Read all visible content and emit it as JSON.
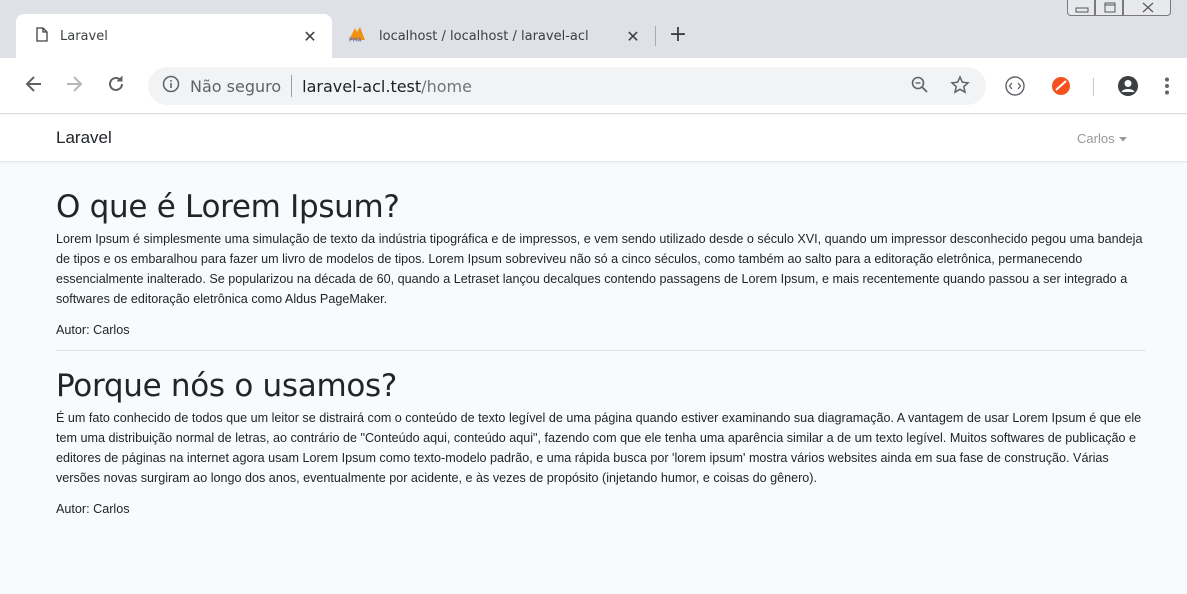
{
  "browser": {
    "tabs": [
      {
        "title": "Laravel",
        "icon": "document-icon"
      },
      {
        "title": "localhost / localhost / laravel-acl",
        "icon": "phpmyadmin-icon"
      }
    ],
    "new_tab": "+",
    "address": {
      "security_label": "Não seguro",
      "host": "laravel-acl.test",
      "path": "/home"
    }
  },
  "app": {
    "brand": "Laravel",
    "user_menu": "Carlos"
  },
  "posts": [
    {
      "title": "O que é Lorem Ipsum?",
      "body": "Lorem Ipsum é simplesmente uma simulação de texto da indústria tipográfica e de impressos, e vem sendo utilizado desde o século XVI, quando um impressor desconhecido pegou uma bandeja de tipos e os embaralhou para fazer um livro de modelos de tipos. Lorem Ipsum sobreviveu não só a cinco séculos, como também ao salto para a editoração eletrônica, permanecendo essencialmente inalterado. Se popularizou na década de 60, quando a Letraset lançou decalques contendo passagens de Lorem Ipsum, e mais recentemente quando passou a ser integrado a softwares de editoração eletrônica como Aldus PageMaker.",
      "author": "Autor: Carlos"
    },
    {
      "title": "Porque nós o usamos?",
      "body": "É um fato conhecido de todos que um leitor se distrairá com o conteúdo de texto legível de uma página quando estiver examinando sua diagramação. A vantagem de usar Lorem Ipsum é que ele tem uma distribuição normal de letras, ao contrário de \"Conteúdo aqui, conteúdo aqui\", fazendo com que ele tenha uma aparência similar a de um texto legível. Muitos softwares de publicação e editores de páginas na internet agora usam Lorem Ipsum como texto-modelo padrão, e uma rápida busca por 'lorem ipsum' mostra vários websites ainda em sua fase de construção. Várias versões novas surgiram ao longo dos anos, eventualmente por acidente, e às vezes de propósito (injetando humor, e coisas do gênero).",
      "author": "Autor: Carlos"
    }
  ]
}
